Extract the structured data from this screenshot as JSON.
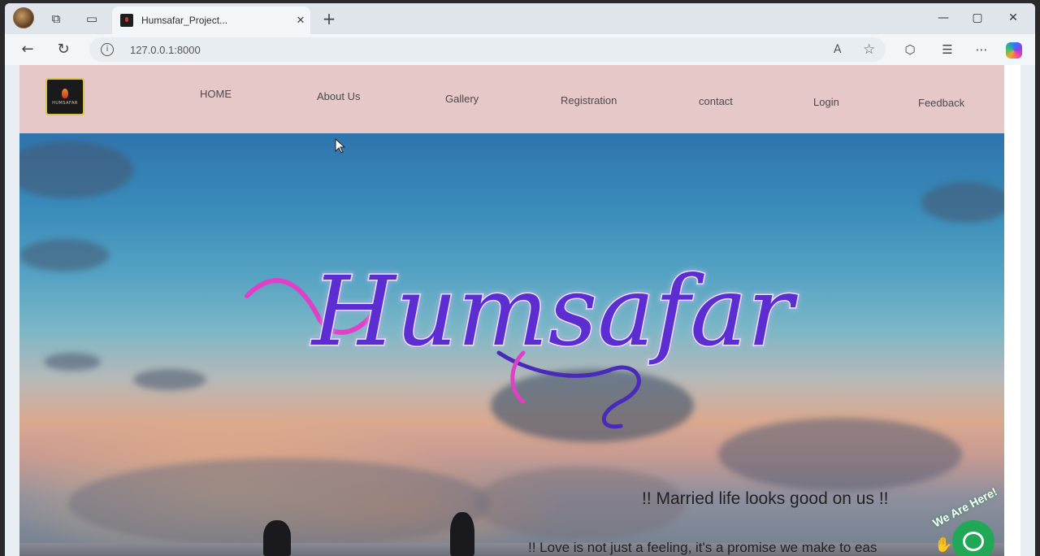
{
  "browser": {
    "tab_title": "Humsafar_Project...",
    "tab_close_glyph": "✕",
    "new_tab_glyph": "+",
    "url": "127.0.0.1:8000",
    "read_aloud_glyph": "A",
    "favorite_glyph": "☆",
    "window_controls": [
      "—",
      "▢",
      "✕"
    ]
  },
  "site": {
    "logo_text": "HUMSAFAR",
    "nav": [
      {
        "label": "HOME"
      },
      {
        "label": "About Us"
      },
      {
        "label": "Gallery"
      },
      {
        "label": "Registration"
      },
      {
        "label": "contact"
      },
      {
        "label": "Login"
      },
      {
        "label": "Feedback"
      }
    ],
    "hero": {
      "title": "Humsafar",
      "tagline": "!! Married life looks good on us !!",
      "subline": "!! Love is not just a feeling, it's a promise we make to eas"
    },
    "chat": {
      "label": "We Are Here!"
    }
  },
  "colors": {
    "navbar_bg": "#e7c8c8",
    "title_purple": "#5b2fd1",
    "title_pink": "#e040c8",
    "chat_green": "#20a857"
  }
}
